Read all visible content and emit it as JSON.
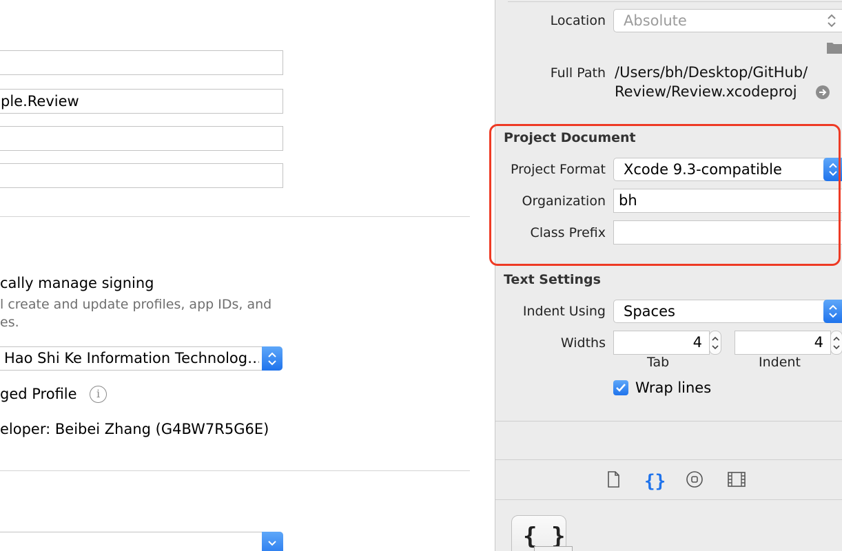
{
  "left": {
    "fields": [
      {
        "value": ""
      },
      {
        "value": "ple.Review"
      },
      {
        "value": ""
      },
      {
        "value": ""
      }
    ],
    "signing": {
      "auto_label": "cally manage signing",
      "auto_desc_line1": "l create and update profiles, app IDs, and",
      "auto_desc_line2": "es.",
      "team_value": "Hao Shi Ke Information Technolog…",
      "profile_label": "ged Profile",
      "info_glyph": "i",
      "certificate": "eloper: Beibei Zhang (G4BW7R5G6E)"
    }
  },
  "inspector": {
    "location_label": "Location",
    "location_value": "Absolute",
    "full_path_label": "Full Path",
    "full_path_line1": "/Users/bh/Desktop/GitHub/",
    "full_path_line2": "Review/Review.xcodeproj",
    "project_document_header": "Project Document",
    "project_format_label": "Project Format",
    "project_format_value": "Xcode 9.3-compatible",
    "organization_label": "Organization",
    "organization_value": "bh",
    "class_prefix_label": "Class Prefix",
    "class_prefix_value": "",
    "text_settings_header": "Text Settings",
    "indent_using_label": "Indent Using",
    "indent_using_value": "Spaces",
    "widths_label": "Widths",
    "tab_width": "4",
    "indent_width": "4",
    "tab_label": "Tab",
    "indent_label": "Indent",
    "wrap_lines_label": "Wrap lines",
    "wrap_lines_checked": true,
    "library_tile_glyph": "{ }"
  },
  "colors": {
    "accent_blue": "#1f73ec",
    "highlight_red": "#ee3a24"
  }
}
